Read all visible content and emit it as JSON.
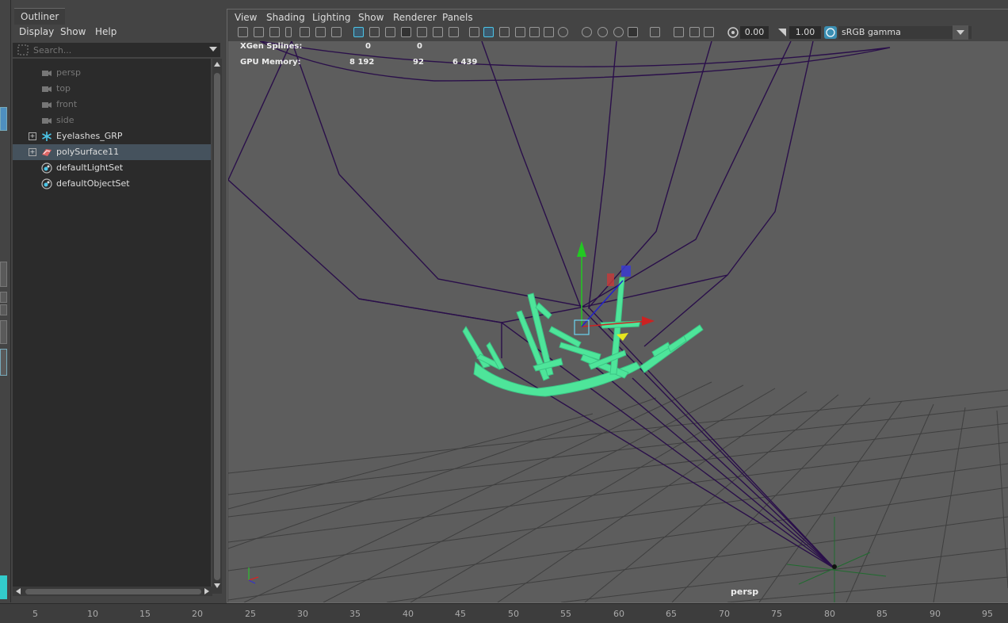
{
  "outliner": {
    "tab": "Outliner",
    "menu": [
      "Display",
      "Show",
      "Help"
    ],
    "search_placeholder": "Search...",
    "items": [
      {
        "label": "persp",
        "icon": "camera-icon",
        "dim": true
      },
      {
        "label": "top",
        "icon": "camera-icon",
        "dim": true
      },
      {
        "label": "front",
        "icon": "camera-icon",
        "dim": true
      },
      {
        "label": "side",
        "icon": "camera-icon",
        "dim": true
      },
      {
        "label": "Eyelashes_GRP",
        "icon": "xgen-asterisk-icon",
        "dim": false
      },
      {
        "label": "polySurface11",
        "icon": "mesh-icon",
        "dim": false,
        "selected": true
      },
      {
        "label": "defaultLightSet",
        "icon": "set-icon",
        "dim": false
      },
      {
        "label": "defaultObjectSet",
        "icon": "set-icon",
        "dim": false
      }
    ]
  },
  "viewport": {
    "menu": [
      "View",
      "Shading",
      "Lighting",
      "Show",
      "Renderer",
      "Panels"
    ],
    "exposure": "0.00",
    "gamma": "1.00",
    "color_space": "sRGB gamma",
    "camera_label": "persp",
    "hud": {
      "xgen_label": "XGen Splines:",
      "xgen_v1": "0",
      "xgen_v2": "0",
      "gpu_label": "GPU Memory:",
      "gpu_v1": "8 192",
      "gpu_v2": "92",
      "gpu_v3": "6 439"
    }
  },
  "ruler": {
    "ticks": [
      "5",
      "10",
      "15",
      "20",
      "25",
      "30",
      "35",
      "40",
      "45",
      "50",
      "55",
      "60",
      "65",
      "70",
      "75",
      "80",
      "85",
      "90",
      "95"
    ]
  },
  "colors": {
    "selection": "#45525d",
    "mesh": "#4ee59a",
    "wire": "#2a0f4a",
    "viewport_bg": "#5d5d5d"
  }
}
